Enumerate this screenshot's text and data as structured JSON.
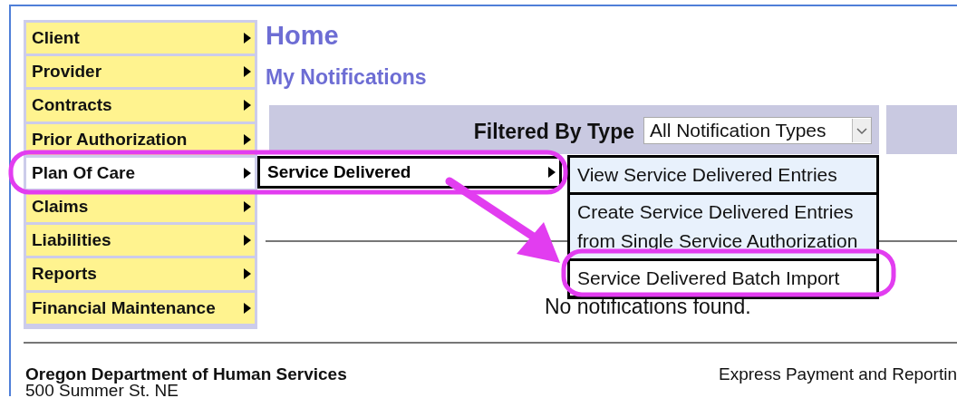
{
  "sidebar": {
    "items": [
      {
        "label": "Client",
        "selected": false
      },
      {
        "label": "Provider",
        "selected": false
      },
      {
        "label": "Contracts",
        "selected": false
      },
      {
        "label": "Prior Authorization",
        "selected": false
      },
      {
        "label": "Plan Of Care",
        "selected": true
      },
      {
        "label": "Claims",
        "selected": false
      },
      {
        "label": "Liabilities",
        "selected": false
      },
      {
        "label": "Reports",
        "selected": false
      },
      {
        "label": "Financial Maintenance",
        "selected": false
      }
    ]
  },
  "submenu": {
    "items": [
      {
        "label": "Service Delivered",
        "selected": true
      }
    ]
  },
  "flyout": {
    "items": [
      {
        "label": "View Service Delivered Entries",
        "selected": false
      },
      {
        "label": "Create Service Delivered Entries from Single Service Authorization",
        "selected": false
      },
      {
        "label": "Service Delivered Batch Import",
        "selected": true
      }
    ]
  },
  "page": {
    "title": "Home",
    "subtitle": "My Notifications"
  },
  "filter": {
    "label": "Filtered By Type",
    "value": "All Notification Types"
  },
  "empty_message": "No notifications found.",
  "footer": {
    "org": "Oregon Department of Human Services",
    "address": "500 Summer St. NE",
    "app": "Express Payment and Reportin"
  }
}
